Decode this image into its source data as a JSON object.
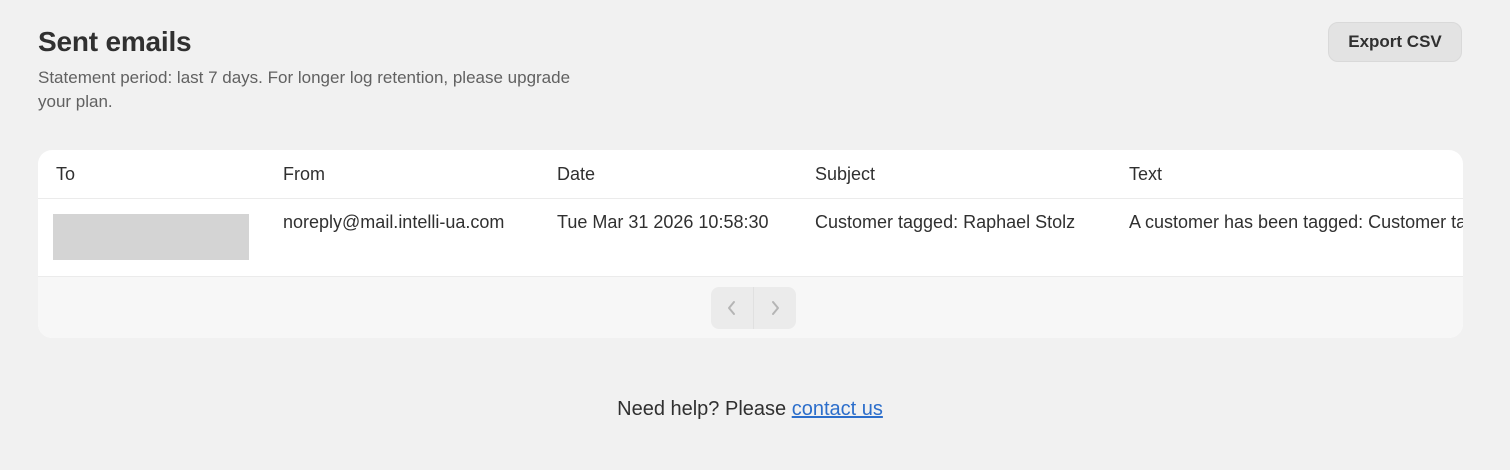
{
  "header": {
    "title": "Sent emails",
    "subtitle": "Statement period: last 7 days. For longer log retention, please upgrade your plan.",
    "export_label": "Export CSV"
  },
  "table": {
    "columns": [
      "To",
      "From",
      "Date",
      "Subject",
      "Text"
    ],
    "rows": [
      {
        "to": "",
        "from": "noreply@mail.intelli-ua.com",
        "date": "Tue Mar 31 2026 10:58:30",
        "subject": "Customer tagged: Raphael Stolz",
        "text": "A customer has been tagged: Customer tagged: Raphael Stolz"
      }
    ]
  },
  "pagination": {
    "prev_icon": "chevron-left-icon",
    "next_icon": "chevron-right-icon"
  },
  "footer": {
    "help_text": "Need help? Please",
    "link_text": "contact us"
  },
  "colors": {
    "background": "#f1f1f1",
    "card": "#ffffff",
    "link": "#2c6ecb",
    "button": "#e3e3e3"
  }
}
